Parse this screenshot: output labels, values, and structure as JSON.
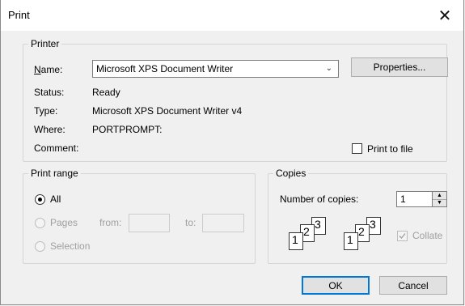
{
  "window": {
    "title": "Print",
    "close_icon": "close-icon"
  },
  "printer_group": {
    "legend": "Printer",
    "name_label": "Name:",
    "name_value": "Microsoft XPS Document Writer",
    "properties_button": "Properties...",
    "status_label": "Status:",
    "status_value": "Ready",
    "type_label": "Type:",
    "type_value": "Microsoft XPS Document Writer v4",
    "where_label": "Where:",
    "where_value": "PORTPROMPT:",
    "comment_label": "Comment:",
    "comment_value": "",
    "print_to_file_label": "Print to file",
    "print_to_file_checked": false
  },
  "print_range": {
    "legend": "Print range",
    "all_label": "All",
    "all_selected": true,
    "pages_label": "Pages",
    "from_label": "from:",
    "to_label": "to:",
    "from_value": "",
    "to_value": "",
    "selection_label": "Selection"
  },
  "copies": {
    "legend": "Copies",
    "number_label": "Number of copies:",
    "number_value": "1",
    "collate_label": "Collate",
    "collate_checked": true
  },
  "buttons": {
    "ok": "OK",
    "cancel": "Cancel"
  },
  "colors": {
    "default_button_border": "#0078d7",
    "background": "#f0f0f0"
  }
}
